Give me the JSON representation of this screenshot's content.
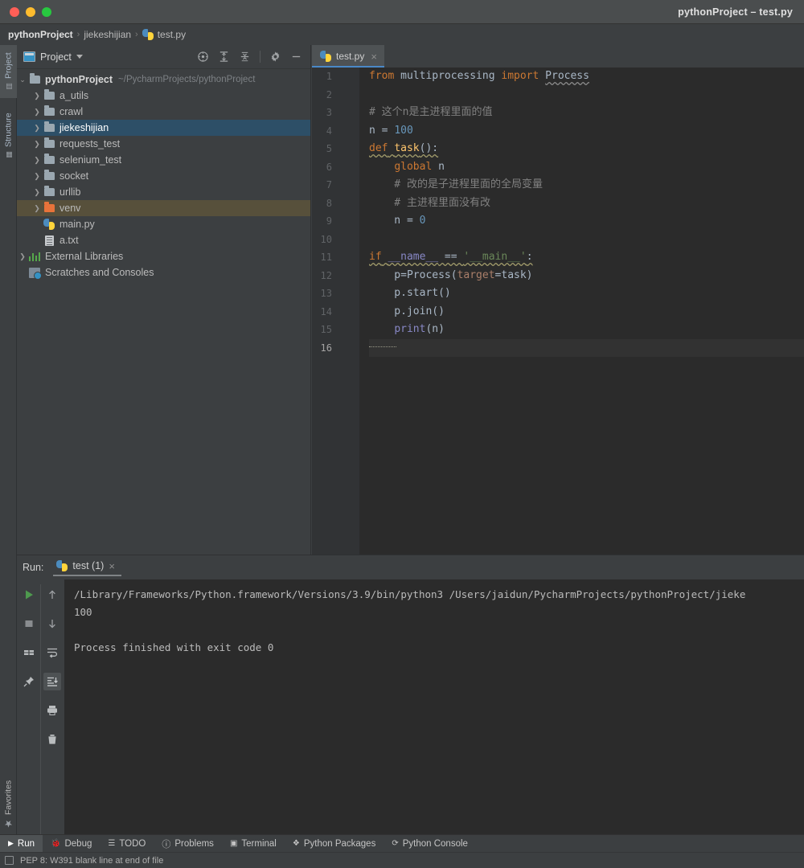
{
  "window": {
    "title": "pythonProject – test.py",
    "traffic_lights": [
      "close",
      "minimize",
      "zoom"
    ]
  },
  "breadcrumb": {
    "items": [
      {
        "label": "pythonProject",
        "bold": true,
        "icon": null
      },
      {
        "label": "jiekeshijian",
        "bold": false,
        "icon": null
      },
      {
        "label": "test.py",
        "bold": false,
        "icon": "python-file-icon"
      }
    ],
    "separator": "›"
  },
  "left_tool_strip": {
    "tabs": [
      {
        "label": "Project",
        "icon": "project-icon",
        "selected": true
      },
      {
        "label": "Structure",
        "icon": "structure-icon",
        "selected": false
      }
    ],
    "bottom_tabs": [
      {
        "label": "Favorites",
        "icon": "star-icon",
        "selected": false
      }
    ]
  },
  "project_panel": {
    "title": "Project",
    "icon": "project-window-icon",
    "dropdown_icon": "chevron-down-icon",
    "toolbar": [
      {
        "name": "select-opened-file-icon",
        "title": "Select Opened File"
      },
      {
        "name": "expand-all-icon",
        "title": "Expand All"
      },
      {
        "name": "collapse-all-icon",
        "title": "Collapse All"
      },
      {
        "name": "settings-gear-icon",
        "title": "Settings"
      },
      {
        "name": "hide-icon",
        "title": "Hide"
      }
    ],
    "tree": [
      {
        "label": "pythonProject",
        "path": "~/PycharmProjects/pythonProject",
        "icon": "folder",
        "indent": 0,
        "arrow": "expanded",
        "bold": true,
        "state": "normal"
      },
      {
        "label": "a_utils",
        "path": "",
        "icon": "folder",
        "indent": 1,
        "arrow": "collapsed",
        "bold": false,
        "state": "normal"
      },
      {
        "label": "crawl",
        "path": "",
        "icon": "folder",
        "indent": 1,
        "arrow": "collapsed",
        "bold": false,
        "state": "normal"
      },
      {
        "label": "jiekeshijian",
        "path": "",
        "icon": "folder",
        "indent": 1,
        "arrow": "collapsed",
        "bold": false,
        "state": "selected"
      },
      {
        "label": "requests_test",
        "path": "",
        "icon": "folder",
        "indent": 1,
        "arrow": "collapsed",
        "bold": false,
        "state": "normal"
      },
      {
        "label": "selenium_test",
        "path": "",
        "icon": "folder",
        "indent": 1,
        "arrow": "collapsed",
        "bold": false,
        "state": "normal"
      },
      {
        "label": "socket",
        "path": "",
        "icon": "folder",
        "indent": 1,
        "arrow": "collapsed",
        "bold": false,
        "state": "normal"
      },
      {
        "label": "urllib",
        "path": "",
        "icon": "folder",
        "indent": 1,
        "arrow": "collapsed",
        "bold": false,
        "state": "normal"
      },
      {
        "label": "venv",
        "path": "",
        "icon": "folder-orange",
        "indent": 1,
        "arrow": "collapsed",
        "bold": false,
        "state": "venv"
      },
      {
        "label": "main.py",
        "path": "",
        "icon": "python-file-icon",
        "indent": 1,
        "arrow": "none",
        "bold": false,
        "state": "normal"
      },
      {
        "label": "a.txt",
        "path": "",
        "icon": "text-file-icon",
        "indent": 1,
        "arrow": "none",
        "bold": false,
        "state": "normal"
      },
      {
        "label": "External Libraries",
        "path": "",
        "icon": "libraries-icon",
        "indent": 0,
        "arrow": "collapsed",
        "bold": false,
        "state": "normal"
      },
      {
        "label": "Scratches and Consoles",
        "path": "",
        "icon": "scratches-icon",
        "indent": 0,
        "arrow": "none",
        "bold": false,
        "state": "normal"
      }
    ]
  },
  "editor": {
    "tabs": [
      {
        "label": "test.py",
        "icon": "python-file-icon",
        "active": true,
        "close_icon": "close-icon"
      }
    ],
    "active_line": 16,
    "lines": [
      {
        "n": 1,
        "gutter": "",
        "tokens": [
          {
            "t": "from",
            "c": "kw"
          },
          {
            "t": " multiprocessing ",
            "c": "plain"
          },
          {
            "t": "import",
            "c": "kw"
          },
          {
            "t": " ",
            "c": "plain"
          },
          {
            "t": "Process",
            "c": "wavy-w"
          }
        ]
      },
      {
        "n": 2,
        "gutter": "",
        "tokens": []
      },
      {
        "n": 3,
        "gutter": "",
        "tokens": [
          {
            "t": "# 这个n是主进程里面的值",
            "c": "cmt"
          }
        ]
      },
      {
        "n": 4,
        "gutter": "",
        "tokens": [
          {
            "t": "n = ",
            "c": "plain"
          },
          {
            "t": "100",
            "c": "num"
          }
        ]
      },
      {
        "n": 5,
        "gutter": "fold-open",
        "tokens": [
          {
            "t": "def",
            "c": "kw wavy"
          },
          {
            "t": " ",
            "c": "plain wavy"
          },
          {
            "t": "task",
            "c": "fn wavy"
          },
          {
            "t": "():",
            "c": "plain wavy"
          }
        ]
      },
      {
        "n": 6,
        "gutter": "",
        "tokens": [
          {
            "t": "    ",
            "c": "plain"
          },
          {
            "t": "global",
            "c": "kw"
          },
          {
            "t": " n",
            "c": "plain"
          }
        ]
      },
      {
        "n": 7,
        "gutter": "fold-arm-down",
        "tokens": [
          {
            "t": "    # 改的是子进程里面的全局变量",
            "c": "cmt"
          }
        ]
      },
      {
        "n": 8,
        "gutter": "fold-arm-up",
        "tokens": [
          {
            "t": "    # 主进程里面没有改",
            "c": "cmt"
          }
        ]
      },
      {
        "n": 9,
        "gutter": "fold-arm-up",
        "tokens": [
          {
            "t": "    n = ",
            "c": "plain"
          },
          {
            "t": "0",
            "c": "num"
          }
        ]
      },
      {
        "n": 10,
        "gutter": "",
        "tokens": []
      },
      {
        "n": 11,
        "gutter": "run-fold",
        "tokens": [
          {
            "t": "if",
            "c": "kw wavy"
          },
          {
            "t": " ",
            "c": "plain wavy"
          },
          {
            "t": "__name__",
            "c": "bi wavy"
          },
          {
            "t": " == ",
            "c": "plain wavy"
          },
          {
            "t": "'__main__'",
            "c": "str wavy"
          },
          {
            "t": ":",
            "c": "plain wavy"
          }
        ]
      },
      {
        "n": 12,
        "gutter": "",
        "tokens": [
          {
            "t": "    p=Process(",
            "c": "plain"
          },
          {
            "t": "target",
            "c": "param"
          },
          {
            "t": "=task)",
            "c": "plain"
          }
        ]
      },
      {
        "n": 13,
        "gutter": "",
        "tokens": [
          {
            "t": "    p.start()",
            "c": "plain"
          }
        ]
      },
      {
        "n": 14,
        "gutter": "",
        "tokens": [
          {
            "t": "    p.join()",
            "c": "plain"
          }
        ]
      },
      {
        "n": 15,
        "gutter": "fold-arm-up bulb",
        "tokens": [
          {
            "t": "    ",
            "c": "plain"
          },
          {
            "t": "print",
            "c": "bi"
          },
          {
            "t": "(n)",
            "c": "plain"
          }
        ]
      },
      {
        "n": 16,
        "gutter": "",
        "tokens": []
      }
    ]
  },
  "run_panel": {
    "label": "Run:",
    "tab": {
      "label": "test (1)",
      "icon": "python-file-icon",
      "close_icon": "close-icon"
    },
    "sidebar_left": [
      {
        "name": "rerun-icon",
        "title": "Rerun",
        "active": false
      },
      {
        "name": "stop-icon",
        "title": "Stop",
        "active": false
      },
      {
        "name": "layout-icon",
        "title": "Layout",
        "active": false
      },
      {
        "name": "pin-icon",
        "title": "Pin Tab",
        "active": false
      }
    ],
    "sidebar_right": [
      {
        "name": "arrow-up-icon",
        "title": "Up",
        "active": false
      },
      {
        "name": "arrow-down-icon",
        "title": "Down",
        "active": false
      },
      {
        "name": "soft-wrap-icon",
        "title": "Soft-Wrap",
        "active": false
      },
      {
        "name": "scroll-to-end-icon",
        "title": "Scroll to End",
        "active": true
      },
      {
        "name": "print-icon",
        "title": "Print",
        "active": false
      },
      {
        "name": "trash-icon",
        "title": "Clear All",
        "active": false
      }
    ],
    "console_lines": [
      "/Library/Frameworks/Python.framework/Versions/3.9/bin/python3 /Users/jaidun/PycharmProjects/pythonProject/jieke",
      "100",
      "",
      "Process finished with exit code 0"
    ]
  },
  "bottom_bar": {
    "items": [
      {
        "label": "Run",
        "icon": "run-triangle-icon",
        "selected": true
      },
      {
        "label": "Debug",
        "icon": "debug-bug-icon",
        "selected": false
      },
      {
        "label": "TODO",
        "icon": "todo-list-icon",
        "selected": false
      },
      {
        "label": "Problems",
        "icon": "problems-info-icon",
        "selected": false
      },
      {
        "label": "Terminal",
        "icon": "terminal-icon",
        "selected": false
      },
      {
        "label": "Python Packages",
        "icon": "packages-icon",
        "selected": false
      },
      {
        "label": "Python Console",
        "icon": "python-console-icon",
        "selected": false
      }
    ]
  },
  "status_bar": {
    "icon": "inspection-icon",
    "message": "PEP 8: W391 blank line at end of file"
  }
}
